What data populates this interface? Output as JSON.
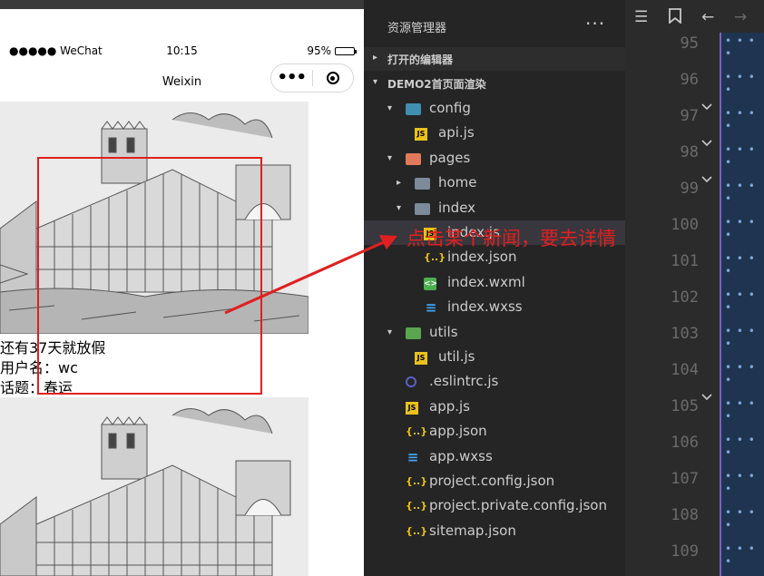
{
  "phone": {
    "status": {
      "carrier": "●●●●● WeChat",
      "time": "10:15",
      "battery": "95%",
      "battery_level": 0.95
    },
    "nav_title": "Weixin",
    "news": [
      {
        "holiday": "还有37天就放假",
        "username": "用户名：wc",
        "topic": "话题：春运"
      },
      {
        "holiday": "",
        "username": "",
        "topic": ""
      }
    ]
  },
  "explorer": {
    "title": "资源管理器",
    "more": "···",
    "sections": {
      "open_editors": "打开的编辑器",
      "project": "DEMO2首页面渲染"
    },
    "tree": [
      {
        "arrow": "▾",
        "icon": "folder-config",
        "name": "config",
        "depth": 0
      },
      {
        "arrow": "",
        "icon": "js",
        "name": "api.js",
        "depth": 1
      },
      {
        "arrow": "▾",
        "icon": "folder-pages",
        "name": "pages",
        "depth": 0
      },
      {
        "arrow": "▸",
        "icon": "folder",
        "name": "home",
        "depth": 1
      },
      {
        "arrow": "▾",
        "icon": "folder",
        "name": "index",
        "depth": 1
      },
      {
        "arrow": "",
        "icon": "js",
        "name": "index.js",
        "depth": 2
      },
      {
        "arrow": "",
        "icon": "json",
        "name": "index.json",
        "depth": 2
      },
      {
        "arrow": "",
        "icon": "wxml",
        "name": "index.wxml",
        "depth": 2
      },
      {
        "arrow": "",
        "icon": "wxss",
        "name": "index.wxss",
        "depth": 2
      },
      {
        "arrow": "▾",
        "icon": "folder-utils",
        "name": "utils",
        "depth": 0
      },
      {
        "arrow": "",
        "icon": "js",
        "name": "util.js",
        "depth": 1
      },
      {
        "arrow": "",
        "icon": "eslint",
        "name": ".eslintrc.js",
        "depth": 0
      },
      {
        "arrow": "",
        "icon": "js",
        "name": "app.js",
        "depth": 0
      },
      {
        "arrow": "",
        "icon": "json",
        "name": "app.json",
        "depth": 0
      },
      {
        "arrow": "",
        "icon": "wxss",
        "name": "app.wxss",
        "depth": 0
      },
      {
        "arrow": "",
        "icon": "json",
        "name": "project.config.json",
        "depth": 0
      },
      {
        "arrow": "",
        "icon": "json",
        "name": "project.private.config.json",
        "depth": 0
      },
      {
        "arrow": "",
        "icon": "json",
        "name": "sitemap.json",
        "depth": 0
      }
    ],
    "selected": "index.js"
  },
  "editor": {
    "line_numbers": [
      "95",
      "96",
      "97",
      "98",
      "99",
      "100",
      "101",
      "102",
      "103",
      "104",
      "105",
      "106",
      "107",
      "108",
      "109"
    ],
    "folded_lines": [
      "96",
      "97",
      "98",
      "104"
    ],
    "toolbar_icons": [
      "outline-icon",
      "bookmark-icon",
      "back-arrow-icon",
      "forward-arrow-icon"
    ]
  },
  "annotation": {
    "text": "点击某个新闻，要去详情",
    "color": "#e02020"
  },
  "colors": {
    "accent_red": "#e02020",
    "explorer_bg": "#252526",
    "editor_bg": "#2b2b2b",
    "selected_row": "#37373d"
  }
}
